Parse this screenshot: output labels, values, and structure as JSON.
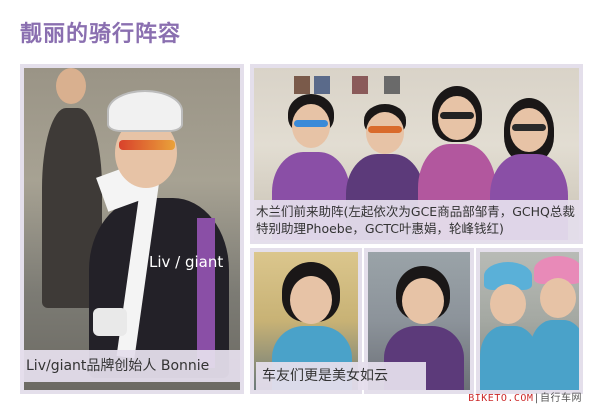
{
  "page": {
    "title": "靓丽的骑行阵容"
  },
  "photos": {
    "left": {
      "caption": "Liv/giant品牌创始人 Bonnie",
      "jersey_text": "Liv / giant"
    },
    "group": {
      "caption": "木兰们前来助阵(左起依次为GCE商品部邹青，GCHQ总裁特别助理Phoebe，GCTC叶惠娟，轮峰钱红)"
    },
    "bottom": {
      "caption": "车友们更是美女如云"
    }
  },
  "watermark": {
    "site": "BIKETO.COM",
    "separator": "|",
    "cn": "自行车网"
  },
  "colors": {
    "title": "#8a6fb0",
    "caption_bg": "#e4deec",
    "jersey_purple": "#8a4fa6",
    "jersey_blue": "#4aa2c9"
  }
}
